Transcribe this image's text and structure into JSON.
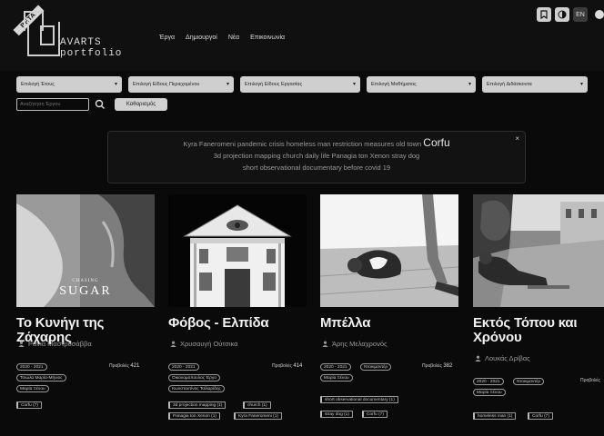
{
  "logo": {
    "badge": "BETA",
    "line1": "AVARTS",
    "line2": "portfolio"
  },
  "nav": [
    "Έργα",
    "Δημιουργοί",
    "Νέα",
    "Επικοινωνία"
  ],
  "top_icons": {
    "lang": "EN"
  },
  "filters": [
    "Επιλογή Έτους",
    "Επιλογή Είδους Περιεχομένου",
    "Επιλογή Είδους Εργασίας",
    "Επιλογή Μαθήματος",
    "Επιλογή Διδάσκοντα"
  ],
  "search": {
    "placeholder": "Αναζήτηση Έργου",
    "clear_label": "Καθαρισμός"
  },
  "tag_cloud": {
    "line1": [
      "Kyra Faneromeni",
      "pandemic crisis",
      "homeless man",
      "restriction measures",
      "old town"
    ],
    "line1_big": "Corfu",
    "line2": [
      "3d projection mapping",
      "church",
      "daily life",
      "Panagia ton Xenon",
      "stray dog"
    ],
    "line3": [
      "short observational documentary",
      "before covid 19"
    ],
    "close": "×"
  },
  "cards": [
    {
      "title": "Το Κυνήγι της Ζάχαρης",
      "poster_small": "CHASING",
      "poster_big": "SUGAR",
      "author": "Ράνια Μαστροσάββα",
      "year": "2020 - 2021",
      "views_label": "Προβολές",
      "views": "421",
      "people": [
        "Τσιώλα Μαρία-Μήνιος",
        "Μαρία Ξένου"
      ],
      "tags": [
        "Corfu (7)"
      ]
    },
    {
      "title": "Φόβος - Ελπίδα",
      "author": "Χρυσαυγή Ούτσικα",
      "year": "2020 - 2021",
      "views_label": "Προβολές",
      "views": "414",
      "people": [
        "Οικονομοπουλος Έργο",
        "Κωνσταντίνος Τσίλαρίδης"
      ],
      "tags": [
        "3d projection mapping (1)",
        "church (1)",
        "Panagia ton Xenon (1)",
        "Kyra Faneromeni (1)"
      ]
    },
    {
      "title": "Μπέλλα",
      "author": "Άρης Μελαχρονός",
      "year": "2020 - 2021",
      "type": "Ντοκιμαντέρ",
      "views_label": "Προβολές",
      "views": "382",
      "people": [
        "Μαρία Ξένου"
      ],
      "tags": [
        "short observational documentary (1)",
        "stray dog (1)",
        "Corfu (7)"
      ]
    },
    {
      "title": "Εκτός Τόπου και Χρόνου",
      "author": "Λουκάς Δρίβας",
      "year": "2020 - 2021",
      "type": "Ντοκιμαντέρ",
      "views_label": "Προβολές",
      "people": [
        "Μαρία Ξένου"
      ],
      "tags": [
        "homeless man (1)",
        "Corfu (7)"
      ]
    }
  ]
}
